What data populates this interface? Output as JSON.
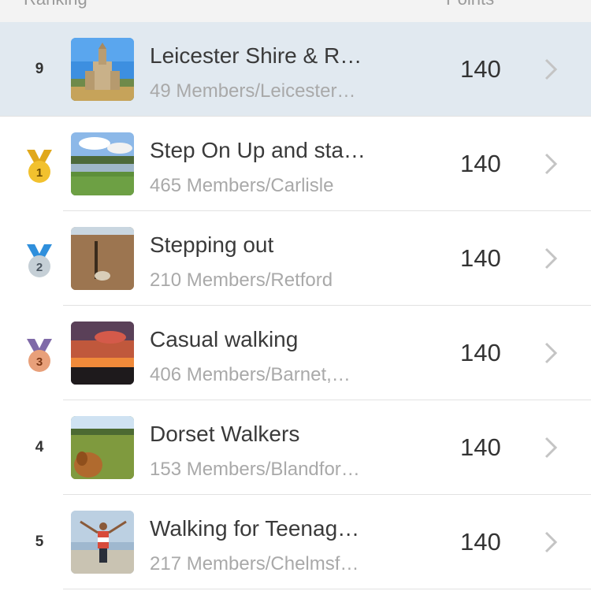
{
  "header": {
    "ranking_label": "Ranking",
    "points_label": "Points"
  },
  "rows": [
    {
      "rank": "9",
      "title": "Leicester Shire & R…",
      "subtitle": "49 Members/Leicester…",
      "points": "140"
    },
    {
      "rank": "1",
      "title": "Step On Up and sta…",
      "subtitle": "465 Members/Carlisle",
      "points": "140"
    },
    {
      "rank": "2",
      "title": "Stepping out",
      "subtitle": "210 Members/Retford",
      "points": "140"
    },
    {
      "rank": "3",
      "title": "Casual walking",
      "subtitle": "406 Members/Barnet,…",
      "points": "140"
    },
    {
      "rank": "4",
      "title": "Dorset Walkers",
      "subtitle": "153 Members/Blandfor…",
      "points": "140"
    },
    {
      "rank": "5",
      "title": "Walking for Teenag…",
      "subtitle": "217 Members/Chelmsf…",
      "points": "140"
    }
  ],
  "colors": {
    "highlight_row": "#e1e9f0",
    "gold_medal": "#f2c12e",
    "silver_medal": "#c5cfd6",
    "bronze_medal": "#e8a07a"
  }
}
